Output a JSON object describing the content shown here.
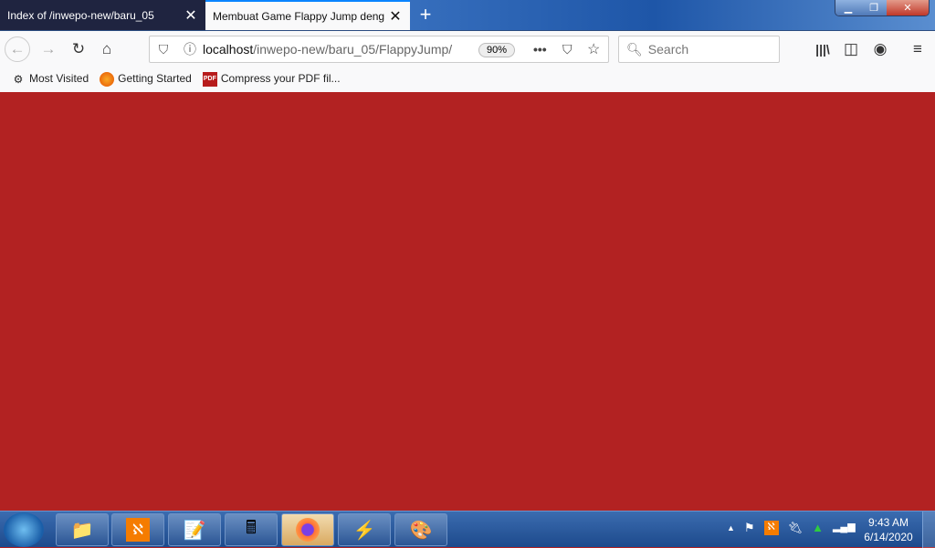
{
  "tabs": [
    {
      "label": "Index of /inwepo-new/baru_05"
    },
    {
      "label": "Membuat Game Flappy Jump deng"
    }
  ],
  "window": {
    "minimize": "▁",
    "restore": "❐",
    "close": "✕"
  },
  "nav": {
    "url_host": "localhost",
    "url_path": "/inwepo-new/baru_05/FlappyJump/",
    "zoom": "90%",
    "search_placeholder": "Search"
  },
  "bookmarks": [
    {
      "label": "Most Visited",
      "icon": "gear-icon"
    },
    {
      "label": "Getting Started",
      "icon": "firefox-icon"
    },
    {
      "label": "Compress your PDF fil...",
      "icon": "pdf-icon"
    }
  ],
  "page": {
    "background": "#b22222"
  },
  "taskbar": {
    "time": "9:43 AM",
    "date": "6/14/2020"
  }
}
